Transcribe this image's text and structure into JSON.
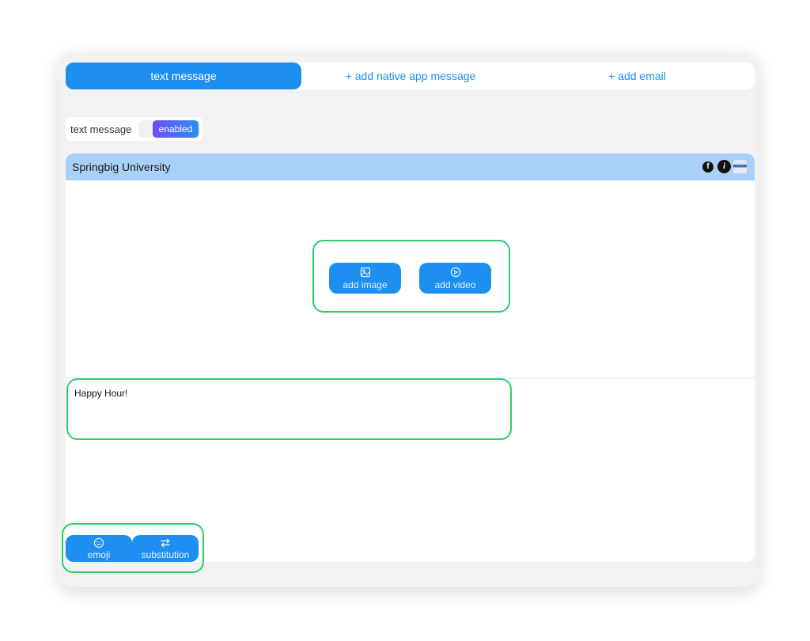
{
  "tabs": [
    {
      "label": "text message",
      "active": true
    },
    {
      "label": "+ add native app message",
      "active": false
    },
    {
      "label": "+ add email",
      "active": false
    }
  ],
  "channel_toggle": {
    "label": "text message",
    "state": "enabled"
  },
  "message": {
    "sender": "Springbig University",
    "header_icons": [
      "facebook-icon",
      "info-icon",
      "flag-icon"
    ],
    "media_buttons": [
      {
        "label": "add image",
        "icon": "image-icon"
      },
      {
        "label": "add video",
        "icon": "play-circle-icon"
      }
    ],
    "body_text": "Happy Hour!"
  },
  "toolbar": {
    "emoji_label": "emoji",
    "substitution_label": "substitution"
  },
  "colors": {
    "accent": "#1d8ff0",
    "header_bg": "#a9d0f6",
    "highlight_outline": "#2ecc71",
    "toggle_gradient_start": "#6a4ff2",
    "toggle_gradient_end": "#2f8cf0"
  }
}
